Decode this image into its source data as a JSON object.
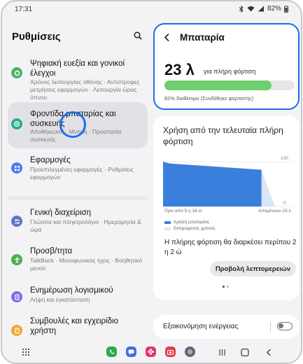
{
  "status_bar": {
    "time": "17:31",
    "battery": "82%"
  },
  "left_pane": {
    "title": "Ρυθμίσεις",
    "items": [
      {
        "title": "Ψηφιακή ευεξία και γονικοί έλεγχοι",
        "subtitle": "Χρόνος λειτουργίας οθόνης · Αντίστροφες μετρήσεις εφαρμογών · Λειτουργία ώρας ύπνου",
        "icon": "digital-wellbeing-icon",
        "color": "#4cb36b"
      },
      {
        "title": "Φροντίδα μπαταρίας και συσκευής",
        "subtitle": "Αποθήκευση · Μνήμη · Προστασία συσκευής",
        "icon": "device-care-icon",
        "color": "#2dac8e"
      },
      {
        "title": "Εφαρμογές",
        "subtitle": "Προεπιλεγμένες εφαρμογές · Ρυθμίσεις εφαρμογών",
        "icon": "apps-icon",
        "color": "#4a7df0"
      },
      {
        "title": "Γενική διαχείριση",
        "subtitle": "Γλώσσα και πληκτρολόγιο · Ημερομηνία & ώρα",
        "icon": "general-management-icon",
        "color": "#5e77c4"
      },
      {
        "title": "Προσβ/τητα",
        "subtitle": "TalkBack · Μονοφωνικός ήχος · Βοηθητικό μενού",
        "icon": "accessibility-icon",
        "color": "#4caf50"
      },
      {
        "title": "Ενημέρωση λογισμικού",
        "subtitle": "Λήψη και εγκατάσταση",
        "icon": "software-update-icon",
        "color": "#7b6fe0"
      },
      {
        "title": "Συμβουλές και εγχειρίδιο χρήστη",
        "subtitle": "",
        "icon": "tips-icon",
        "color": "#f0a830"
      }
    ]
  },
  "battery_card": {
    "title": "Μπαταρία",
    "time_left": "23 λ",
    "time_left_unit": "για πλήρη φόρτιση",
    "level": 0.82,
    "status": "82% διαθέσιμο (Συνδέθηκε φορτιστής)"
  },
  "usage_card": {
    "title": "Χρήση από την τελευταία πλήρη φόρτιση",
    "estimate": "Η πλήρης φόρτιση θα διαρκέσει περίπου 2 η 2 ώ",
    "details_button": "Προβολή λεπτομερειών"
  },
  "chart_data": {
    "type": "area",
    "ylim": [
      0,
      100
    ],
    "ytick_labels": [
      "100",
      "0"
    ],
    "x_start_label": "Πριν από 5 η 16 ώ",
    "x_end_label": "Απομένουν 23 λ",
    "series": [
      {
        "name": "Χρήση μπαταρίας",
        "color": "#3b7fdc",
        "values": [
          100,
          96,
          95,
          94,
          93,
          92,
          91,
          90,
          89,
          88,
          87,
          86,
          85,
          84,
          83,
          82
        ]
      },
      {
        "name": "Εκτιμώμενος χρόνος",
        "color": "#dbe6f7",
        "values": [
          82,
          60,
          40,
          20,
          0
        ]
      }
    ]
  },
  "power_card": {
    "label": "Εξοικονόμηση ενέργειας",
    "enabled": false
  }
}
